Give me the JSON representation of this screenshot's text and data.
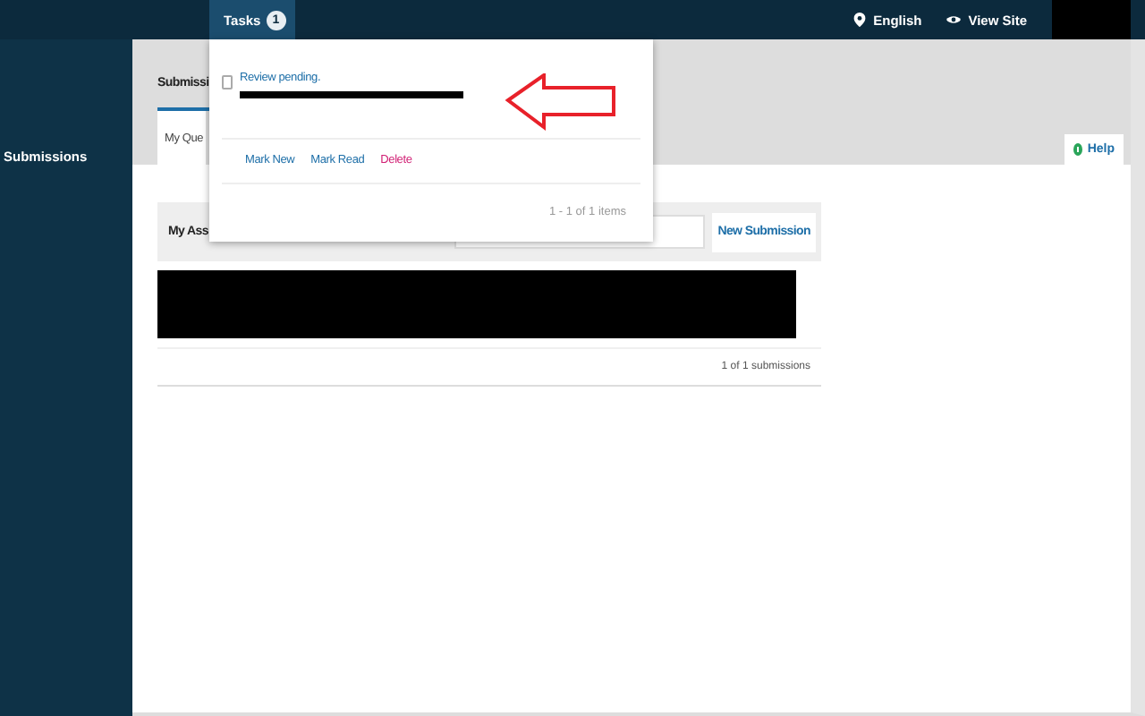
{
  "top_bar": {
    "tasks_tab": {
      "label": "Tasks",
      "count": "1"
    },
    "links": [
      {
        "kind": "language",
        "label": "English"
      },
      {
        "kind": "site",
        "label": "View Site"
      }
    ]
  },
  "sidebar": {
    "items": [
      {
        "label": "Submissions"
      }
    ]
  },
  "header": {
    "tabs": [
      {
        "label": "Submissi",
        "selected": true
      }
    ],
    "sub_tabs": [
      {
        "label": "My Que",
        "selected": true
      }
    ],
    "help": "Help"
  },
  "panel": {
    "title": "My Ass",
    "new_button": "New Submission",
    "footer": "1 of 1 submissions"
  },
  "tasks_menu": {
    "tasks": [
      {
        "title": "Review pending.",
        "checked": false
      }
    ],
    "actions": [
      {
        "kind": "normal",
        "label": "Mark New"
      },
      {
        "kind": "normal",
        "label": "Mark Read"
      },
      {
        "kind": "danger",
        "label": "Delete"
      }
    ],
    "pagination": "1 - 1 of 1 items"
  }
}
